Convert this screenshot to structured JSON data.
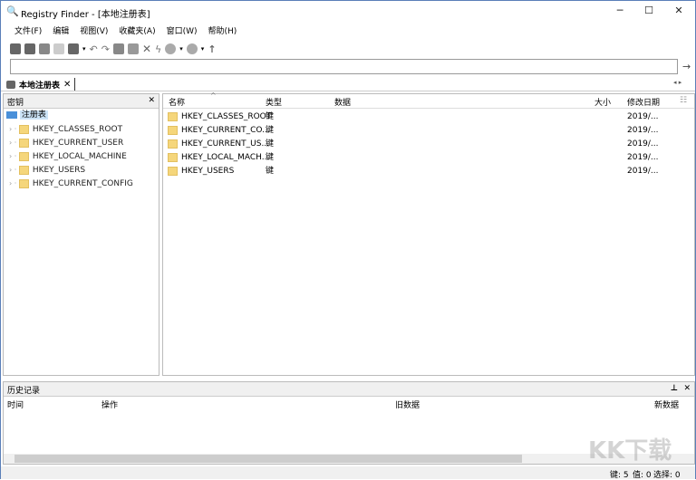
{
  "window": {
    "title": "Registry Finder - [本地注册表]",
    "minimize": "─",
    "maximize": "☐",
    "close": "✕"
  },
  "menu": [
    "文件(F)",
    "编辑",
    "视图(V)",
    "收藏夹(A)",
    "窗口(W)",
    "帮助(H)"
  ],
  "address": {
    "value": "",
    "go": "→"
  },
  "tab": {
    "label": "本地注册表",
    "close": "✕"
  },
  "tree": {
    "header": "密钥",
    "close": "✕",
    "root": "注册表",
    "items": [
      "HKEY_CLASSES_ROOT",
      "HKEY_CURRENT_USER",
      "HKEY_LOCAL_MACHINE",
      "HKEY_USERS",
      "HKEY_CURRENT_CONFIG"
    ]
  },
  "list": {
    "columns": [
      "名称",
      "类型",
      "数据",
      "大小",
      "修改日期"
    ],
    "rows": [
      {
        "name": "HKEY_CLASSES_ROOT",
        "type": "键",
        "date": "2019/..."
      },
      {
        "name": "HKEY_CURRENT_CO...",
        "type": "键",
        "date": "2019/..."
      },
      {
        "name": "HKEY_CURRENT_US...",
        "type": "键",
        "date": "2019/..."
      },
      {
        "name": "HKEY_LOCAL_MACH...",
        "type": "键",
        "date": "2019/..."
      },
      {
        "name": "HKEY_USERS",
        "type": "键",
        "date": "2019/..."
      }
    ]
  },
  "history": {
    "title": "历史记录",
    "pin": "⊥",
    "close": "✕",
    "columns": [
      "时间",
      "操作",
      "旧数据",
      "新数据"
    ]
  },
  "status": {
    "keys": "键: 5",
    "values": "值: 0",
    "selected": "选择: 0"
  },
  "watermark": "KK下载"
}
